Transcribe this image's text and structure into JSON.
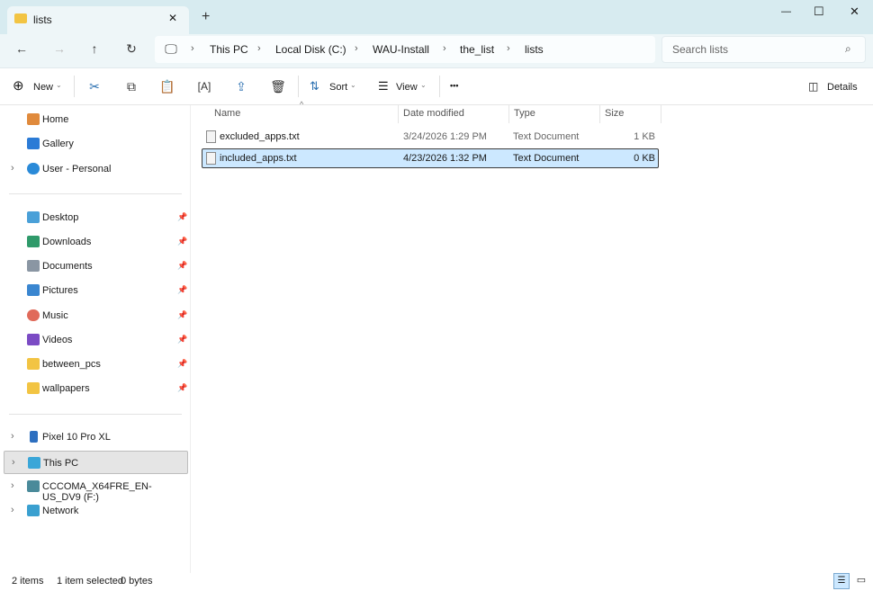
{
  "window": {
    "tab_title": "lists",
    "new_tab": "+",
    "minimize": "—",
    "maximize": "☐",
    "close": "✕"
  },
  "address": {
    "segments": [
      "This PC",
      "Local Disk (C:)",
      "WAU-Install",
      "the_list",
      "lists"
    ],
    "search_placeholder": "Search lists"
  },
  "toolbar": {
    "new": "New",
    "sort": "Sort",
    "view": "View",
    "more": "•••",
    "details": "Details"
  },
  "sidebar": {
    "top": [
      {
        "label": "Home",
        "icon": "home-icon",
        "color": "#e08a3c"
      },
      {
        "label": "Gallery",
        "icon": "gallery-icon",
        "color": "#2b7bd6"
      },
      {
        "label": "User - Personal",
        "icon": "cloud-icon",
        "color": "#2a8ad8"
      }
    ],
    "pinned": [
      {
        "label": "Desktop",
        "icon": "desktop-icon",
        "color": "#4aa0d8"
      },
      {
        "label": "Downloads",
        "icon": "downloads-icon",
        "color": "#2f9a6a"
      },
      {
        "label": "Documents",
        "icon": "documents-icon",
        "color": "#8a96a3"
      },
      {
        "label": "Pictures",
        "icon": "pictures-icon",
        "color": "#3a86d0"
      },
      {
        "label": "Music",
        "icon": "music-icon",
        "color": "#e06a5a"
      },
      {
        "label": "Videos",
        "icon": "videos-icon",
        "color": "#7b4bc4"
      },
      {
        "label": "between_pcs",
        "icon": "folder-icon",
        "color": "#f2c443"
      },
      {
        "label": "wallpapers",
        "icon": "folder-icon",
        "color": "#f2c443"
      }
    ],
    "devices": [
      {
        "label": "Pixel 10 Pro XL",
        "icon": "phone-icon",
        "color": "#2d6fc0"
      },
      {
        "label": "This PC",
        "icon": "pc-icon",
        "color": "#3aa6d8",
        "selected": true
      },
      {
        "label": "CCCOMA_X64FRE_EN-US_DV9 (F:)",
        "icon": "drive-icon",
        "color": "#4a8a9a"
      },
      {
        "label": "Network",
        "icon": "network-icon",
        "color": "#3aa0d0"
      }
    ]
  },
  "columns": {
    "name": "Name",
    "date": "Date modified",
    "type": "Type",
    "size": "Size"
  },
  "files": [
    {
      "name": "excluded_apps.txt",
      "date": "3/24/2026 1:29 PM",
      "type": "Text Document",
      "size": "1 KB"
    },
    {
      "name": "included_apps.txt",
      "date": "4/23/2026 1:32 PM",
      "type": "Text Document",
      "size": "0 KB",
      "selected": true
    }
  ],
  "status": {
    "count": "2 items",
    "selection": "1 item selected",
    "bytes": "0 bytes"
  }
}
